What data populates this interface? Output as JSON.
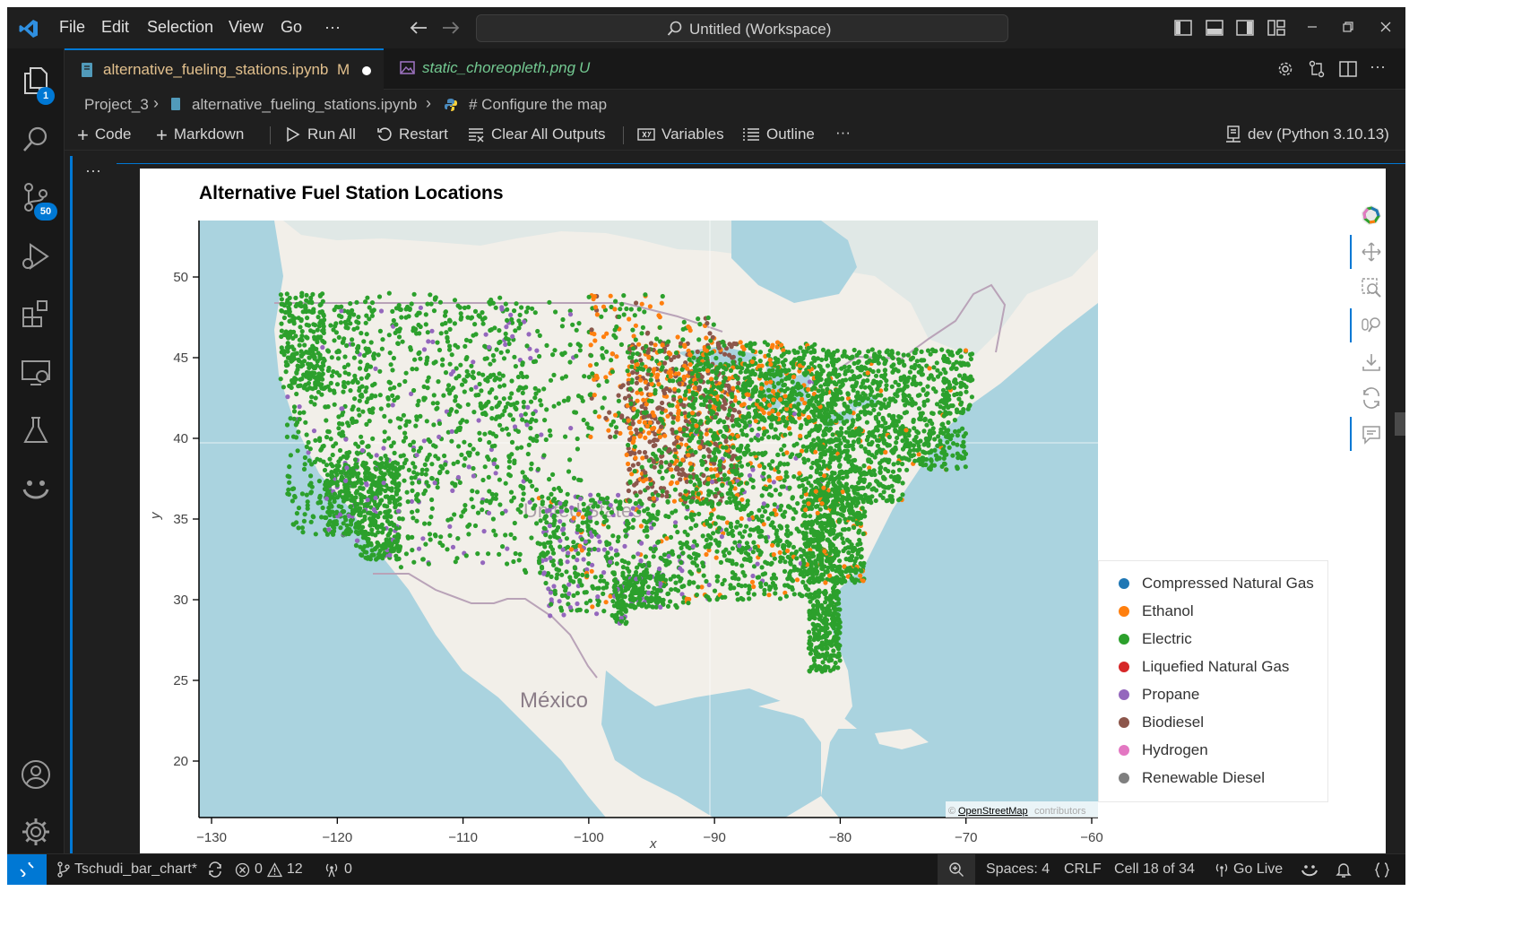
{
  "titlebar": {
    "menu": [
      "File",
      "Edit",
      "Selection",
      "View",
      "Go",
      "···"
    ],
    "command_center": "Untitled (Workspace)"
  },
  "activity_bar": {
    "explorer_badge": "1",
    "scm_badge": "50"
  },
  "tabs": [
    {
      "label": "alternative_fueling_stations.ipynb",
      "status": "M",
      "active": true,
      "color": "#e2c08d"
    },
    {
      "label": "static_choreopleth.png",
      "status": "U",
      "active": false,
      "color": "#73c991"
    }
  ],
  "breadcrumb": [
    "Project_3",
    "alternative_fueling_stations.ipynb",
    "# Configure the map"
  ],
  "notebook_toolbar": {
    "code": "Code",
    "markdown": "Markdown",
    "run_all": "Run All",
    "restart": "Restart",
    "clear_outputs": "Clear All Outputs",
    "variables": "Variables",
    "outline": "Outline",
    "more": "···",
    "kernel": "dev (Python 3.10.13)"
  },
  "cell_gutter": "···",
  "chart_data": {
    "type": "scatter",
    "title": "Alternative Fuel Station Locations",
    "xlabel": "x",
    "ylabel": "y",
    "xlim": [
      -131,
      -59.5
    ],
    "ylim": [
      16.5,
      53.5
    ],
    "x_ticks": [
      -130,
      -120,
      -110,
      -100,
      -90,
      -80,
      -70,
      -60
    ],
    "y_ticks": [
      20,
      25,
      30,
      35,
      40,
      45,
      50
    ],
    "x_tick_labels": [
      "−130",
      "−120",
      "−110",
      "−100",
      "−90",
      "−80",
      "−70",
      "−60"
    ],
    "y_tick_labels": [
      "20",
      "25",
      "30",
      "35",
      "40",
      "45",
      "50"
    ],
    "legend_placement": "bottom-right outside",
    "series": [
      {
        "name": "Compressed Natural Gas",
        "color": "#1f77b4"
      },
      {
        "name": "Ethanol",
        "color": "#ff7f0e"
      },
      {
        "name": "Electric",
        "color": "#2ca02c"
      },
      {
        "name": "Liquefied Natural Gas",
        "color": "#d62728"
      },
      {
        "name": "Propane",
        "color": "#9467bd"
      },
      {
        "name": "Biodiesel",
        "color": "#8c564b"
      },
      {
        "name": "Hydrogen",
        "color": "#e377c2"
      },
      {
        "name": "Renewable Diesel",
        "color": "#7f7f7f"
      }
    ],
    "map_labels": {
      "country_us": "United States",
      "country_mx": "México"
    },
    "attribution": {
      "prefix": "© ",
      "link": "OpenStreetMap",
      "suffix": " contributors"
    },
    "grid": false
  },
  "statusbar": {
    "branch": "Tschudi_bar_chart*",
    "errors": "0",
    "warnings": "12",
    "ports": "0",
    "spaces": "Spaces: 4",
    "eol": "CRLF",
    "cell": "Cell 18 of 34",
    "go_live": "Go Live"
  }
}
